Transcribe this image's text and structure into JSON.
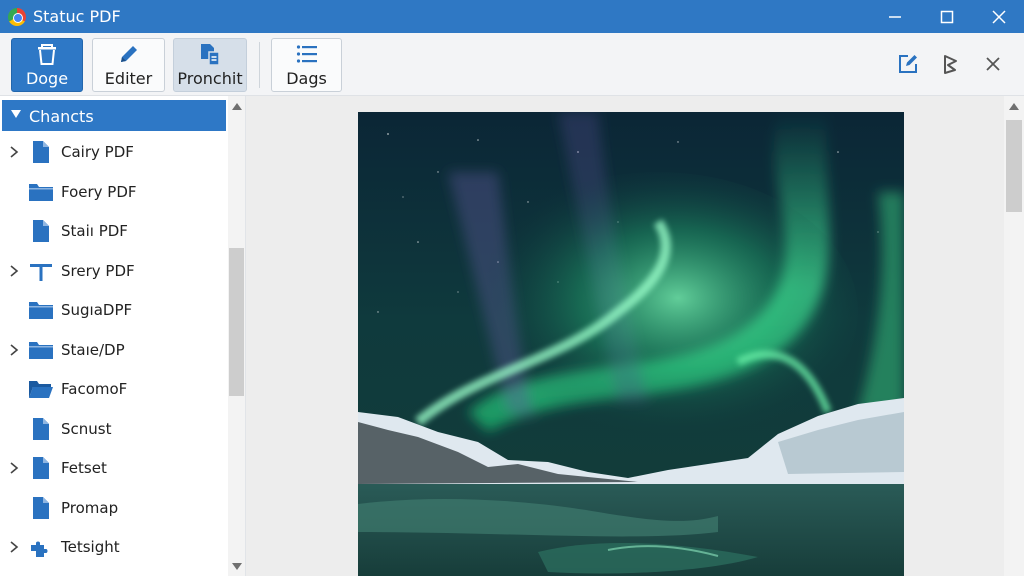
{
  "window": {
    "title": "Statuc PDF"
  },
  "toolbar": {
    "buttons": [
      {
        "label": "Doge",
        "icon": "trash-icon"
      },
      {
        "label": "Editer",
        "icon": "pencil-icon"
      },
      {
        "label": "Pronchit",
        "icon": "file-copy-icon"
      },
      {
        "label": "Dags",
        "icon": "list-icon"
      }
    ],
    "right_icons": [
      "edit-square-icon",
      "flag-icon",
      "close-icon"
    ]
  },
  "sidebar": {
    "header": "Chancts",
    "items": [
      {
        "label": "Cairy PDF",
        "icon": "file-icon",
        "expandable": true
      },
      {
        "label": "Foery PDF",
        "icon": "folder-icon",
        "expandable": false
      },
      {
        "label": "Staiı PDF",
        "icon": "file-icon",
        "expandable": false
      },
      {
        "label": "Srery PDF",
        "icon": "pin-icon",
        "expandable": true
      },
      {
        "label": "SugıaDPF",
        "icon": "folder-icon",
        "expandable": false
      },
      {
        "label": "Staıe/DP",
        "icon": "folder-icon",
        "expandable": true
      },
      {
        "label": "FacomoF",
        "icon": "folder-open-icon",
        "expandable": false
      },
      {
        "label": "Scnust",
        "icon": "file-icon",
        "expandable": false
      },
      {
        "label": "Fetset",
        "icon": "file-icon",
        "expandable": true
      },
      {
        "label": "Promap",
        "icon": "file-icon",
        "expandable": false
      },
      {
        "label": "Tetsight",
        "icon": "puzzle-icon",
        "expandable": true
      }
    ]
  },
  "colors": {
    "titlebar": "#2f78c4",
    "accent": "#2e78c6",
    "icon_blue": "#2a72c0"
  }
}
